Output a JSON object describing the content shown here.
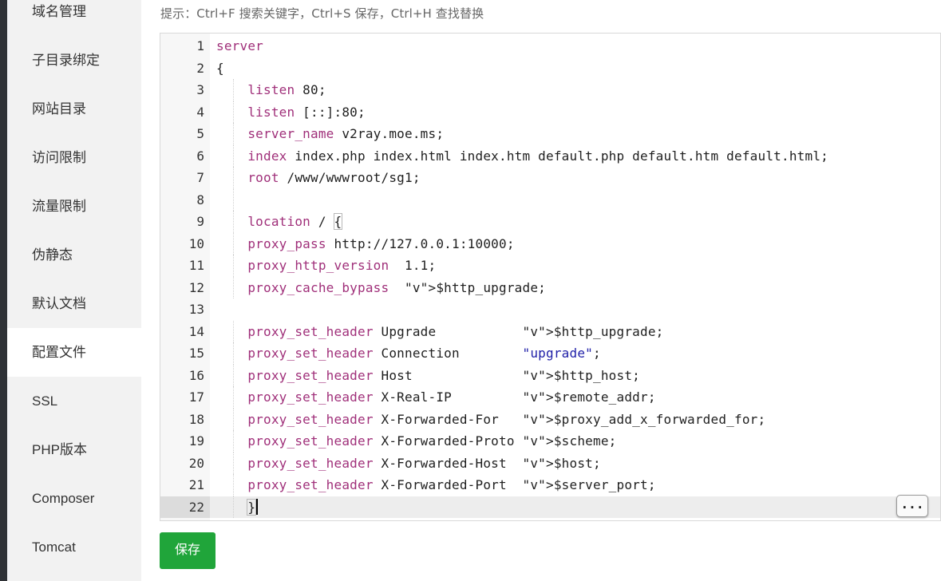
{
  "sidebar": {
    "items": [
      {
        "label": "域名管理"
      },
      {
        "label": "子目录绑定"
      },
      {
        "label": "网站目录"
      },
      {
        "label": "访问限制"
      },
      {
        "label": "流量限制"
      },
      {
        "label": "伪静态"
      },
      {
        "label": "默认文档"
      },
      {
        "label": "配置文件",
        "active": true
      },
      {
        "label": "SSL"
      },
      {
        "label": "PHP版本"
      },
      {
        "label": "Composer"
      },
      {
        "label": "Tomcat"
      }
    ]
  },
  "hint": "提示：Ctrl+F 搜索关键字，Ctrl+S 保存，Ctrl+H 查找替换",
  "editor": {
    "active_line": 22,
    "more_label": "...",
    "lines": [
      {
        "n": "1",
        "code": "server"
      },
      {
        "n": "2",
        "code": "{"
      },
      {
        "n": "3",
        "code": "    listen 80;"
      },
      {
        "n": "4",
        "code": "    listen [::]:80;"
      },
      {
        "n": "5",
        "code": "    server_name v2ray.moe.ms;"
      },
      {
        "n": "6",
        "code": "    index index.php index.html index.htm default.php default.htm default.html;"
      },
      {
        "n": "7",
        "code": "    root /www/wwwroot/sg1;"
      },
      {
        "n": "8",
        "code": "    "
      },
      {
        "n": "9",
        "code": "    location / {"
      },
      {
        "n": "10",
        "code": "    proxy_pass http://127.0.0.1:10000;"
      },
      {
        "n": "11",
        "code": "    proxy_http_version  1.1;"
      },
      {
        "n": "12",
        "code": "    proxy_cache_bypass  $http_upgrade;"
      },
      {
        "n": "13",
        "code": ""
      },
      {
        "n": "14",
        "code": "    proxy_set_header Upgrade           $http_upgrade;"
      },
      {
        "n": "15",
        "code": "    proxy_set_header Connection        \"upgrade\";"
      },
      {
        "n": "16",
        "code": "    proxy_set_header Host              $http_host;"
      },
      {
        "n": "17",
        "code": "    proxy_set_header X-Real-IP         $remote_addr;"
      },
      {
        "n": "18",
        "code": "    proxy_set_header X-Forwarded-For   $proxy_add_x_forwarded_for;"
      },
      {
        "n": "19",
        "code": "    proxy_set_header X-Forwarded-Proto $scheme;"
      },
      {
        "n": "20",
        "code": "    proxy_set_header X-Forwarded-Host  $host;"
      },
      {
        "n": "21",
        "code": "    proxy_set_header X-Forwarded-Port  $server_port;"
      },
      {
        "n": "22",
        "code": "    }"
      }
    ]
  },
  "save_label": "保存",
  "colors": {
    "sidebar_bg": "#f2f2f2",
    "save_button": "#20a53a",
    "keyword": "#a0307a",
    "variable": "#2e8b9a",
    "string": "#2020a8"
  }
}
